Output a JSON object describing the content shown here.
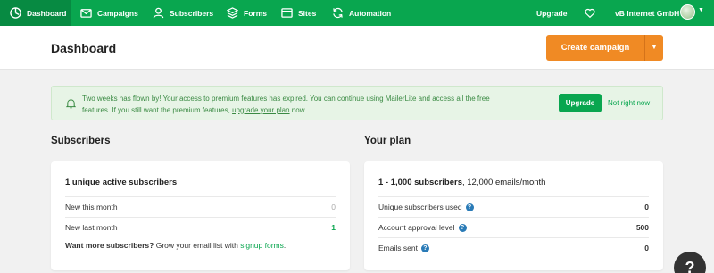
{
  "nav": {
    "items": [
      {
        "label": "Dashboard",
        "icon": "dashboard-icon"
      },
      {
        "label": "Campaigns",
        "icon": "mail-icon"
      },
      {
        "label": "Subscribers",
        "icon": "user-icon"
      },
      {
        "label": "Forms",
        "icon": "layers-icon"
      },
      {
        "label": "Sites",
        "icon": "browser-icon"
      },
      {
        "label": "Automation",
        "icon": "refresh-icon"
      }
    ],
    "upgrade_label": "Upgrade",
    "account_name": "vB Internet GmbH",
    "accent": "#09a64f"
  },
  "header": {
    "title": "Dashboard",
    "create_label": "Create campaign",
    "create_color": "#f08a24"
  },
  "banner": {
    "text_before": "Two weeks has flown by! Your access to premium features has expired. You can continue using MailerLite and access all the free features. If you still want the premium features, ",
    "link_text": "upgrade your plan",
    "text_after": " now.",
    "upgrade_label": "Upgrade",
    "dismiss_label": "Not right now"
  },
  "subscribers": {
    "section_title": "Subscribers",
    "card_title": "1 unique active subscribers",
    "rows": [
      {
        "label": "New this month",
        "value": "0"
      },
      {
        "label": "New last month",
        "value": "1"
      }
    ],
    "more_bold": "Want more subscribers?",
    "more_text": " Grow your email list with ",
    "more_link": "signup forms",
    "more_end": "."
  },
  "plan": {
    "section_title": "Your plan",
    "card_title_bold": "1 - 1,000 subscribers",
    "card_title_rest": ", 12,000 emails/month",
    "rows": [
      {
        "label": "Unique subscribers used",
        "value": "0"
      },
      {
        "label": "Account approval level",
        "value": "500"
      },
      {
        "label": "Emails sent",
        "value": "0"
      }
    ]
  },
  "help": {
    "label": "?"
  }
}
